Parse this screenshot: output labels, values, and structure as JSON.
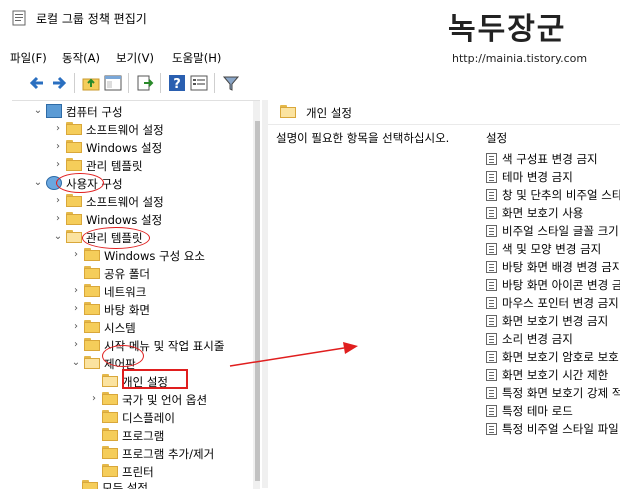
{
  "window": {
    "title": "로컬 그룹 정책 편집기"
  },
  "watermark": {
    "text": "녹두장군",
    "url": "http://mainia.tistory.com"
  },
  "menubar": {
    "items": [
      "파일(F)",
      "동작(A)",
      "보기(V)",
      "도움말(H)"
    ]
  },
  "toolbar": {
    "buttons": [
      "back-icon",
      "forward-icon",
      "up-folder-icon",
      "show-hide-tree-icon",
      "export-list-icon",
      "help-icon",
      "properties-icon",
      "filter-icon"
    ]
  },
  "tree": {
    "computer_config": "컴퓨터 구성",
    "cc_software": "소프트웨어 설정",
    "cc_windows": "Windows 설정",
    "cc_admin": "관리 템플릿",
    "user_config": "사용자 구성",
    "uc_software": "소프트웨어 설정",
    "uc_windows": "Windows 설정",
    "uc_admin": "관리 템플릿",
    "admin_children": [
      "Windows 구성 요소",
      "공유 폴더",
      "네트워크",
      "바탕 화면",
      "시스템",
      "시작 메뉴 및 작업 표시줄",
      "제어판"
    ],
    "control_panel_children": [
      "개인 설정",
      "국가 및 언어 옵션",
      "디스플레이",
      "프로그램",
      "프로그램 추가/제거",
      "프린터",
      "모든 설정"
    ]
  },
  "right_pane": {
    "header": "개인 설정",
    "description": "설명이 필요한 항목을 선택하십시오.",
    "column_header": "설정",
    "settings": [
      "색 구성표 변경 금지",
      "테마 변경 금지",
      "창 및 단추의 비주얼 스타일 변경 금지",
      "화면 보호기 사용",
      "비주얼 스타일 글꼴 크기 선택 금지",
      "색 및 모양 변경 금지",
      "바탕 화면 배경 변경 금지",
      "바탕 화면 아이콘 변경 금지",
      "마우스 포인터 변경 금지",
      "화면 보호기 변경 금지",
      "소리 변경 금지",
      "화면 보호기 암호로 보호",
      "화면 보호기 시간 제한",
      "특정 화면 보호기 강제 적용",
      "특정 테마 로드",
      "특정 비주얼 스타일 파일 강제 적용"
    ]
  },
  "colors": {
    "annotation_red": "#e01e1e",
    "folder_yellow": "#f5cd5a",
    "desktop_blue": "#2b7bd6"
  }
}
